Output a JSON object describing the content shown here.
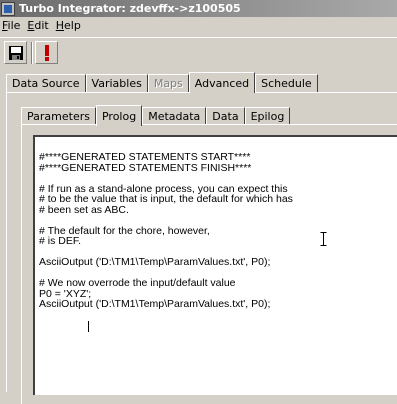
{
  "window": {
    "title": "Turbo Integrator: zdevffx->z100505"
  },
  "menu": {
    "file": "File",
    "file_key": "F",
    "file_rest": "ile",
    "edit": "Edit",
    "edit_key": "E",
    "edit_rest": "dit",
    "help": "Help",
    "help_key": "H",
    "help_rest": "elp"
  },
  "toolbar": {
    "save_icon": "floppy-disk-icon",
    "execute_icon": "exclamation-icon"
  },
  "outer_tabs": [
    {
      "label": "Data Source",
      "state": "normal"
    },
    {
      "label": "Variables",
      "state": "normal"
    },
    {
      "label": "Maps",
      "state": "disabled"
    },
    {
      "label": "Advanced",
      "state": "active"
    },
    {
      "label": "Schedule",
      "state": "normal"
    }
  ],
  "inner_tabs": [
    {
      "label": "Parameters",
      "state": "normal"
    },
    {
      "label": "Prolog",
      "state": "active"
    },
    {
      "label": "Metadata",
      "state": "normal"
    },
    {
      "label": "Data",
      "state": "normal"
    },
    {
      "label": "Epilog",
      "state": "normal"
    }
  ],
  "editor": {
    "lines": [
      "#****GENERATED STATEMENTS START****",
      "#****GENERATED STATEMENTS FINISH****",
      "",
      "# If run as a stand-alone process, you can expect this",
      "# to be the value that is input, the default for which has",
      "# been set as ABC.",
      "",
      "# The default for the chore, however,",
      "# is DEF.",
      "",
      "AsciiOutput ('D:\\TM1\\Temp\\ParamValues.txt', P0);",
      "",
      "# We now overrode the input/default value",
      "P0 = 'XYZ';",
      "AsciiOutput ('D:\\TM1\\Temp\\ParamValues.txt', P0);"
    ]
  },
  "colors": {
    "face": "#d4d0c8",
    "title_gradient_start": "#6b6b6b",
    "title_gradient_end": "#a9a9a9"
  }
}
